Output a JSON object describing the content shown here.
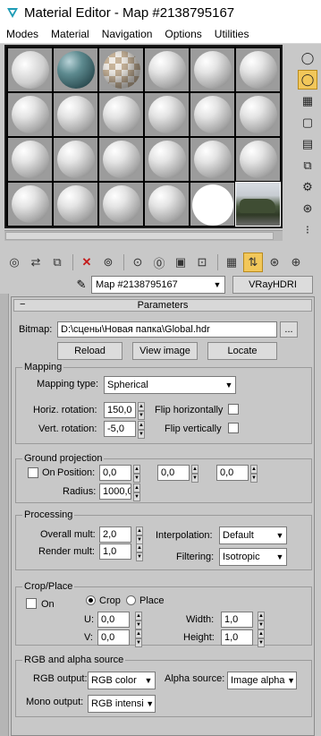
{
  "window": {
    "title": "Material Editor - Map #2138795167"
  },
  "menu": [
    "Modes",
    "Material",
    "Navigation",
    "Options",
    "Utilities"
  ],
  "slots": [
    "cube",
    "teal",
    "checker",
    "plain",
    "plain",
    "plain",
    "plain",
    "plain",
    "plain",
    "plain",
    "plain",
    "plain",
    "plain",
    "plain",
    "plain",
    "plain",
    "plain",
    "plain",
    "plain",
    "plain",
    "plain",
    "plain",
    "white",
    "hdr"
  ],
  "map": {
    "name": "Map #2138795167",
    "type": "VRayHDRI"
  },
  "params": {
    "title": "Parameters",
    "bitmap_label": "Bitmap:",
    "bitmap_path": "D:\\сцены\\Новая папка\\Global.hdr",
    "browse_label": "...",
    "reload": "Reload",
    "view_image": "View image",
    "locate": "Locate",
    "mapping": {
      "title": "Mapping",
      "type_label": "Mapping type:",
      "type_value": "Spherical",
      "horiz_label": "Horiz. rotation:",
      "horiz_value": "150,0",
      "flip_h": "Flip horizontally",
      "vert_label": "Vert. rotation:",
      "vert_value": "-5,0",
      "flip_v": "Flip vertically"
    },
    "ground": {
      "title": "Ground projection",
      "on": "On",
      "position_label": "Position:",
      "pos_x": "0,0",
      "pos_y": "0,0",
      "pos_z": "0,0",
      "radius_label": "Radius:",
      "radius_value": "1000,0"
    },
    "processing": {
      "title": "Processing",
      "overall_label": "Overall mult:",
      "overall_value": "2,0",
      "render_label": "Render mult:",
      "render_value": "1,0",
      "interp_label": "Interpolation:",
      "interp_value": "Default",
      "filter_label": "Filtering:",
      "filter_value": "Isotropic"
    },
    "crop": {
      "title": "Crop/Place",
      "on": "On",
      "crop": "Crop",
      "place": "Place",
      "u_label": "U:",
      "u_value": "0,0",
      "v_label": "V:",
      "v_value": "0,0",
      "width_label": "Width:",
      "width_value": "1,0",
      "height_label": "Height:",
      "height_value": "1,0"
    },
    "rgb": {
      "title": "RGB and alpha source",
      "rgb_label": "RGB output:",
      "rgb_value": "RGB color",
      "alpha_label": "Alpha source:",
      "alpha_value": "Image alpha",
      "mono_label": "Mono output:",
      "mono_value": "RGB intensi"
    }
  }
}
